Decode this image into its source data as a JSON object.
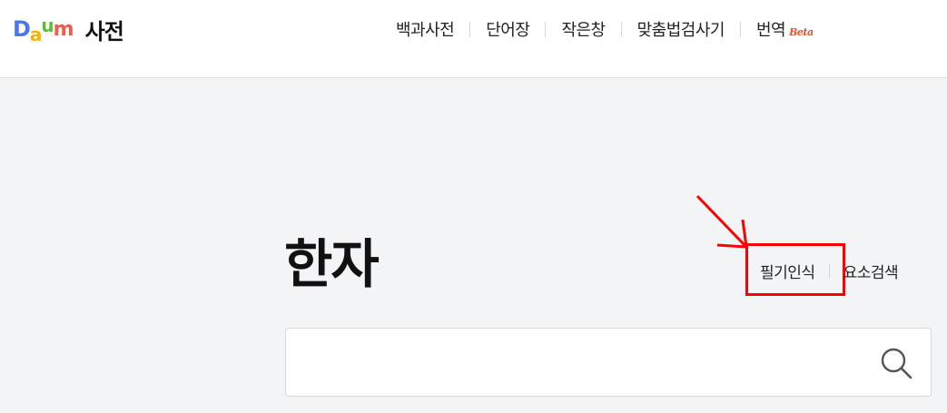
{
  "logo": {
    "letters": [
      {
        "char": "D",
        "color": "#4a78ea"
      },
      {
        "char": "a",
        "color": "#f4b400"
      },
      {
        "char": "u",
        "color": "#5ebe3a"
      },
      {
        "char": "m",
        "color": "#ef5b4a"
      }
    ],
    "title": "사전"
  },
  "nav": {
    "items": [
      "백과사전",
      "단어장",
      "작은창",
      "맞춤법검사기",
      "번역"
    ],
    "beta": "Beta"
  },
  "page": {
    "title": "한자"
  },
  "tools": {
    "handwriting": "필기인식",
    "component_search": "요소검색"
  },
  "search": {
    "value": "",
    "placeholder": "",
    "icon": "magnifier-icon"
  },
  "annotation": {
    "color": "#ff0000"
  }
}
